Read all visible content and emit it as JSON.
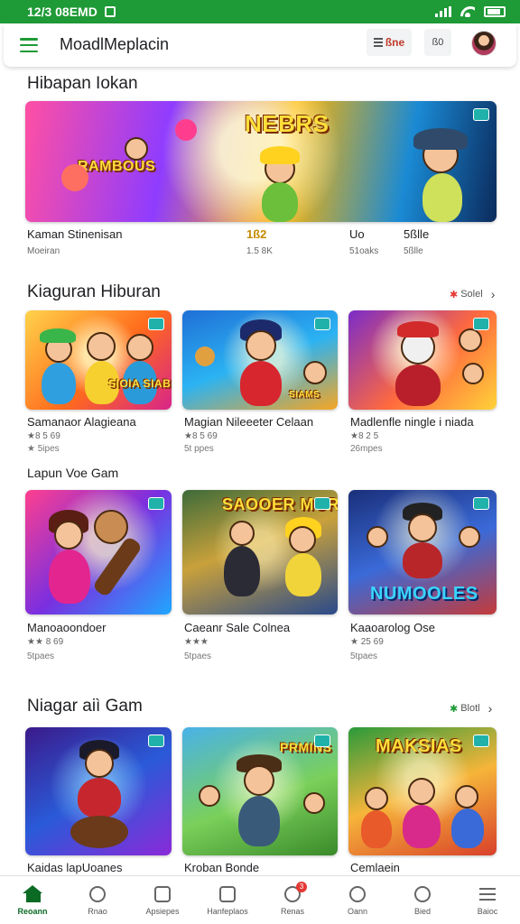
{
  "status_bar": {
    "time": "12/3 08EMD"
  },
  "app_bar": {
    "title": "MoadlMeplacin",
    "store_label": "ßne",
    "gift_label": "ß0"
  },
  "featured": {
    "title": "Hibapa​n Iokan",
    "banner_title": "NEBRS",
    "banner_subtitle": "RAMBOUS",
    "name": "Kaman Stinenisan",
    "sub": "Moeiran",
    "col1_value": "1ß2",
    "col1_sub": "1.5 8K",
    "col2_value": "Uo",
    "col2_sub": "51oaks",
    "col3_value": "5ßlle",
    "col3_sub": "5ßlle"
  },
  "section1": {
    "title": "Kiaguran Hiburan",
    "see_all": "Solel",
    "games": [
      {
        "name": "Samanaor Alagieana",
        "rating": "★8 5 69",
        "meta": "★ 5ipes",
        "art": "SIOIA SIABS"
      },
      {
        "name": "Magian Nileeeter Celaan",
        "rating": "★8 5 69",
        "meta": "5t ppes",
        "art": "SIAMS"
      },
      {
        "name": "Madlenfle ningle i niada",
        "rating": "★8 2 5",
        "meta": "26mpes",
        "art": ""
      }
    ]
  },
  "section2": {
    "title": "Lapun Voe Gam",
    "games": [
      {
        "name": "Manoaoondoer",
        "rating": "★★ 8 69",
        "meta": "5tpaes",
        "art": ""
      },
      {
        "name": "Caeanr Sale Colnea",
        "rating": "★★★",
        "meta": "5tpaes",
        "art": "SAOOER MOROCHIK"
      },
      {
        "name": "Kaaoarolog Ose",
        "rating": "★ 25 69",
        "meta": "5tpaes",
        "art": "NUMOOLES"
      }
    ]
  },
  "section3": {
    "title": "Niagar aiì Gam",
    "see_all": "Blotl",
    "games": [
      {
        "name": "Kaidas lapUoanes",
        "art": ""
      },
      {
        "name": "Kroban Bonde",
        "art": "PRMINS"
      },
      {
        "name": "Cemlaein",
        "art": "MAKSIAS"
      }
    ]
  },
  "bottom_nav": [
    {
      "label": "Reoann",
      "active": true
    },
    {
      "label": "Rnao"
    },
    {
      "label": "Apsiepes"
    },
    {
      "label": "Hanfeplaos"
    },
    {
      "label": "Renas",
      "badge": "3"
    },
    {
      "label": "Oann"
    },
    {
      "label": "Bied"
    },
    {
      "label": "Baioc"
    }
  ],
  "colors": {
    "accent": "#1e9a36",
    "dark_accent": "#0b6b24",
    "badge_red": "#e53935"
  }
}
